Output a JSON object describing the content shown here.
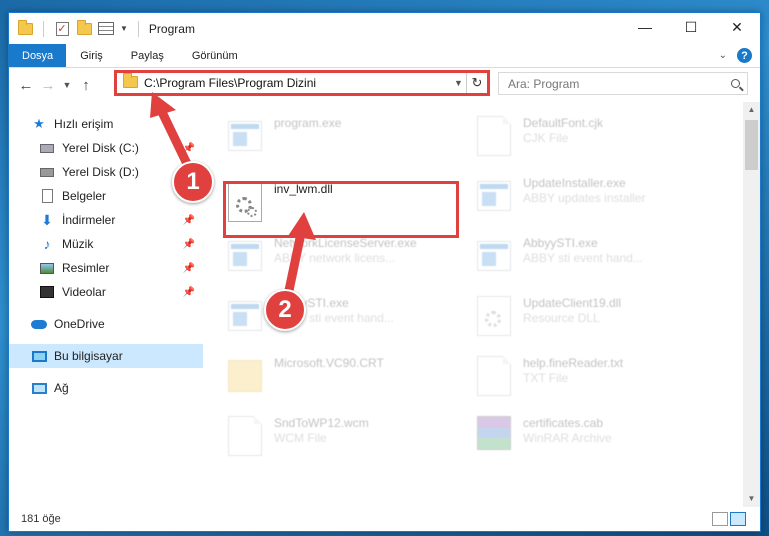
{
  "window": {
    "title": "Program",
    "controls": {
      "minimize": "—",
      "maximize": "☐",
      "close": "✕"
    }
  },
  "ribbon": {
    "tabs": [
      "Dosya",
      "Giriş",
      "Paylaş",
      "Görünüm"
    ],
    "help": "?"
  },
  "nav": {
    "address": "C:\\Program Files\\Program Dizini",
    "search_placeholder": "Ara: Program"
  },
  "sidebar": {
    "quick_access": "Hızlı erişim",
    "items": [
      {
        "label": "Yerel Disk (C:)",
        "pinned": true
      },
      {
        "label": "Yerel Disk (D:)",
        "pinned": false
      },
      {
        "label": "Belgeler",
        "pinned": false
      },
      {
        "label": "İndirmeler",
        "pinned": true
      },
      {
        "label": "Müzik",
        "pinned": true
      },
      {
        "label": "Resimler",
        "pinned": true
      },
      {
        "label": "Videolar",
        "pinned": true
      }
    ],
    "onedrive": "OneDrive",
    "this_pc": "Bu bilgisayar",
    "network": "Ağ"
  },
  "files": [
    {
      "name": "program.exe",
      "desc": "",
      "icon": "exe-icon"
    },
    {
      "name": "DefaultFont.cjk",
      "desc": "CJK File",
      "icon": "document-icon"
    },
    {
      "name": "inv_lwm.dll",
      "desc": "",
      "icon": "dll-gear-icon"
    },
    {
      "name": "UpdateInstaller.exe",
      "desc": "ABBY updates installer",
      "icon": "exe-icon"
    },
    {
      "name": "NetworkLicenseServer.exe",
      "desc": "ABBY network licens...",
      "icon": "exe-icon"
    },
    {
      "name": "AbbyySTI.exe",
      "desc": "ABBY sti event hand...",
      "icon": "exe-icon"
    },
    {
      "name": "AbbyySTI.exe",
      "desc": "ABBY sti event hand...",
      "icon": "exe-icon"
    },
    {
      "name": "UpdateClient19.dll",
      "desc": "Resource DLL",
      "icon": "dll-gear-icon"
    },
    {
      "name": "Microsoft.VC90.CRT",
      "desc": "",
      "icon": "folder-icon"
    },
    {
      "name": "help.fineReader.txt",
      "desc": "TXT File",
      "icon": "document-icon"
    },
    {
      "name": "SndToWP12.wcm",
      "desc": "WCM File",
      "icon": "document-icon"
    },
    {
      "name": "certificates.cab",
      "desc": "WinRAR Archive",
      "icon": "winrar-icon"
    }
  ],
  "callouts": [
    "1",
    "2"
  ],
  "status": {
    "count": "181 öğe"
  }
}
